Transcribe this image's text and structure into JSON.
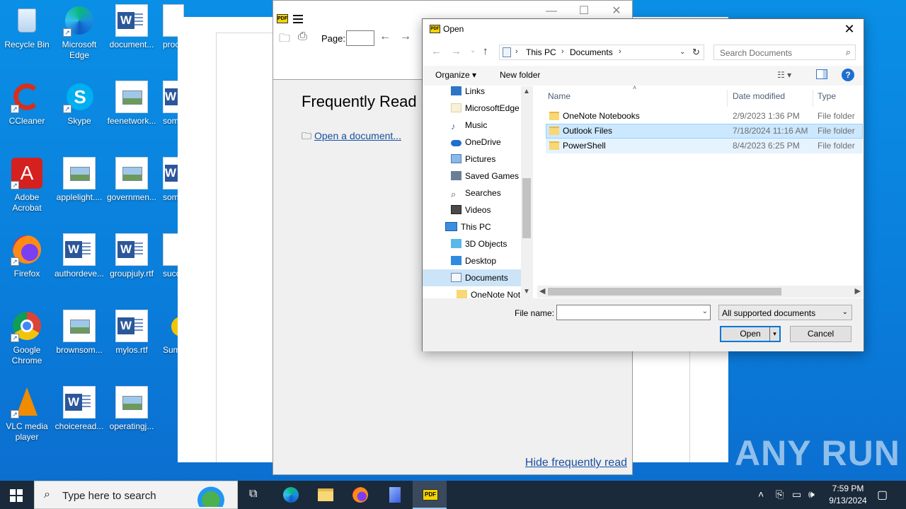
{
  "desktop": {
    "icons": [
      {
        "label": "Recycle Bin",
        "icon": "recycle-bin-icon"
      },
      {
        "label": "Microsoft Edge",
        "icon": "edge-icon"
      },
      {
        "label": "document...",
        "icon": "word-doc-icon"
      },
      {
        "label": "proc",
        "icon": "generic-doc-icon"
      },
      {
        "label": "CCleaner",
        "icon": "ccleaner-icon"
      },
      {
        "label": "Skype",
        "icon": "skype-icon"
      },
      {
        "label": "feenetwork...",
        "icon": "image-file-icon"
      },
      {
        "label": "som",
        "icon": "word-doc-icon"
      },
      {
        "label": "Adobe Acrobat",
        "icon": "acrobat-icon"
      },
      {
        "label": "applelight....",
        "icon": "image-file-icon"
      },
      {
        "label": "governmen...",
        "icon": "image-file-icon"
      },
      {
        "label": "som",
        "icon": "word-doc-icon"
      },
      {
        "label": "Firefox",
        "icon": "firefox-icon"
      },
      {
        "label": "authordeve...",
        "icon": "word-doc-icon"
      },
      {
        "label": "groupjuly.rtf",
        "icon": "word-doc-icon"
      },
      {
        "label": "succ",
        "icon": "generic-doc-icon"
      },
      {
        "label": "Google Chrome",
        "icon": "chrome-icon"
      },
      {
        "label": "brownsom...",
        "icon": "image-file-icon"
      },
      {
        "label": "mylos.rtf",
        "icon": "word-doc-icon"
      },
      {
        "label": "Sum",
        "icon": "generic-doc-icon"
      },
      {
        "label": "VLC media player",
        "icon": "vlc-icon"
      },
      {
        "label": "choiceread...",
        "icon": "word-doc-icon"
      },
      {
        "label": "operatingj...",
        "icon": "image-file-icon"
      }
    ],
    "watermark": "ANY RUN"
  },
  "viewer": {
    "page_label": "Page:",
    "heading": "Frequently Read",
    "open_document": "Open a document...",
    "hide_frequently_read": "Hide frequently read",
    "logo_text": "PDF"
  },
  "dialog": {
    "title": "Open",
    "breadcrumb": [
      "This PC",
      "Documents"
    ],
    "search_placeholder": "Search Documents",
    "organize": "Organize",
    "new_folder": "New folder",
    "help": "?",
    "tree": [
      {
        "label": "Links",
        "icon": "links-icon"
      },
      {
        "label": "MicrosoftEdge",
        "icon": "folder-icon"
      },
      {
        "label": "Music",
        "icon": "music-icon"
      },
      {
        "label": "OneDrive",
        "icon": "onedrive-icon"
      },
      {
        "label": "Pictures",
        "icon": "pictures-icon"
      },
      {
        "label": "Saved Games",
        "icon": "saved-games-icon"
      },
      {
        "label": "Searches",
        "icon": "searches-icon"
      },
      {
        "label": "Videos",
        "icon": "videos-icon"
      },
      {
        "label": "This PC",
        "icon": "this-pc-icon"
      },
      {
        "label": "3D Objects",
        "icon": "3d-objects-icon"
      },
      {
        "label": "Desktop",
        "icon": "desktop-icon"
      },
      {
        "label": "Documents",
        "icon": "documents-icon"
      },
      {
        "label": "OneNote Not",
        "icon": "folder-icon"
      }
    ],
    "columns": {
      "name": "Name",
      "date": "Date modified",
      "type": "Type"
    },
    "files": [
      {
        "name": "OneNote Notebooks",
        "date": "2/9/2023 1:36 PM",
        "type": "File folder"
      },
      {
        "name": "Outlook Files",
        "date": "7/18/2024 11:16 AM",
        "type": "File folder"
      },
      {
        "name": "PowerShell",
        "date": "8/4/2023 6:25 PM",
        "type": "File folder"
      }
    ],
    "file_name_label": "File name:",
    "file_name_value": "",
    "file_type": "All supported documents",
    "open_button": "Open",
    "cancel_button": "Cancel"
  },
  "taskbar": {
    "search_placeholder": "Type here to search",
    "time": "7:59 PM",
    "date": "9/13/2024"
  },
  "colors": {
    "desktop_bg": "#0a7fdc",
    "taskbar_bg": "#1b2a3a",
    "selection": "#cce8ff",
    "link": "#1a4fa0"
  }
}
